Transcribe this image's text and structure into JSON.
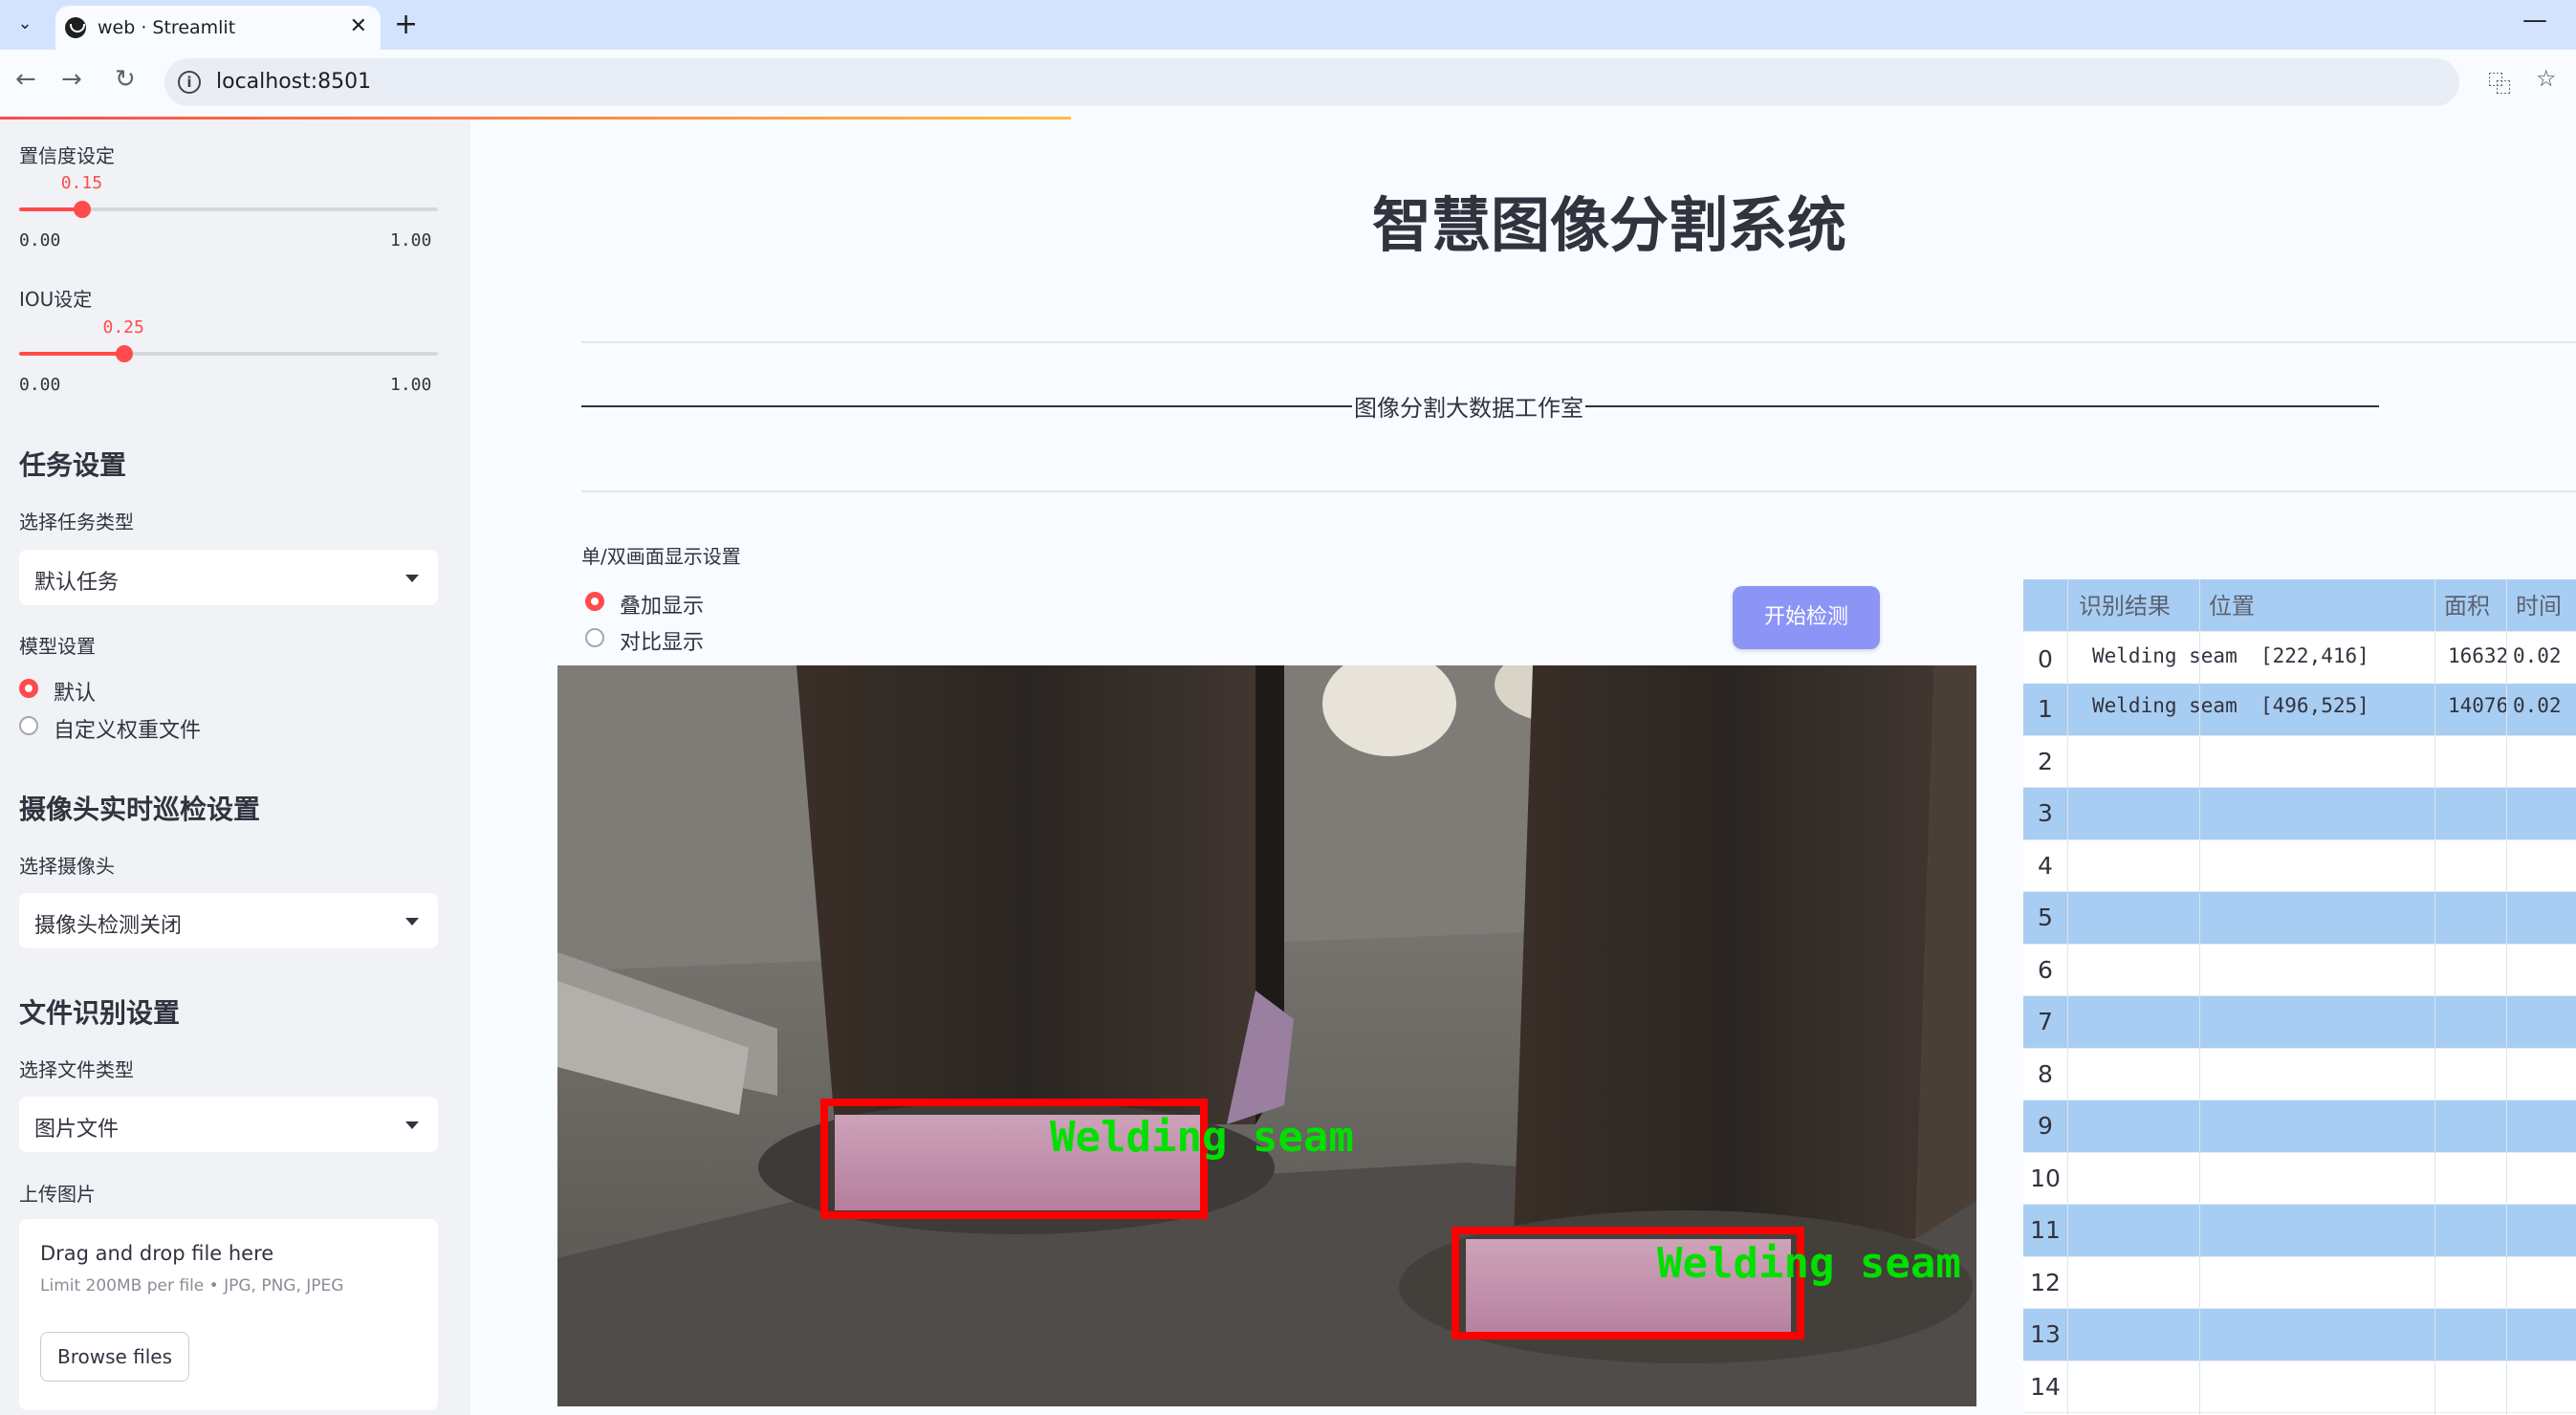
{
  "browser": {
    "tab_title": "web · Streamlit",
    "url": "localhost:8501"
  },
  "sidebar": {
    "confidence": {
      "label": "置信度设定",
      "value": "0.15",
      "min": "0.00",
      "max": "1.00",
      "fraction": 0.15
    },
    "iou": {
      "label": "IOU设定",
      "value": "0.25",
      "min": "0.00",
      "max": "1.00",
      "fraction": 0.25
    },
    "task_section": "任务设置",
    "task_type_label": "选择任务类型",
    "task_type_value": "默认任务",
    "model_label": "模型设置",
    "model_options": [
      "默认",
      "自定义权重文件"
    ],
    "model_selected": 0,
    "camera_section": "摄像头实时巡检设置",
    "camera_label": "选择摄像头",
    "camera_value": "摄像头检测关闭",
    "file_section": "文件识别设置",
    "file_type_label": "选择文件类型",
    "file_type_value": "图片文件",
    "upload_label": "上传图片",
    "upload_drop": "Drag and drop file here",
    "upload_limit": "Limit 200MB per file • JPG, PNG, JPEG",
    "upload_button": "Browse files"
  },
  "main": {
    "title": "智慧图像分割系统",
    "subtitle": "图像分割大数据工作室",
    "display_mode_label": "单/双画面显示设置",
    "display_options": [
      "叠加显示",
      "对比显示"
    ],
    "display_selected": 0,
    "start_button": "开始检测",
    "detections": [
      {
        "label": "Welding seam"
      },
      {
        "label": "Welding seam"
      }
    ]
  },
  "table": {
    "headers": [
      "识别结果",
      "位置",
      "面积",
      "时间"
    ],
    "rows": [
      {
        "index": "0",
        "result": "Welding seam",
        "position": "[222,416]",
        "area": "16632",
        "time": "0.02"
      },
      {
        "index": "1",
        "result": "Welding seam",
        "position": "[496,525]",
        "area": "14076",
        "time": "0.02"
      },
      {
        "index": "2"
      },
      {
        "index": "3"
      },
      {
        "index": "4"
      },
      {
        "index": "5"
      },
      {
        "index": "6"
      },
      {
        "index": "7"
      },
      {
        "index": "8"
      },
      {
        "index": "9"
      },
      {
        "index": "10"
      },
      {
        "index": "11"
      },
      {
        "index": "12"
      },
      {
        "index": "13"
      },
      {
        "index": "14"
      }
    ]
  },
  "colors": {
    "accent": "#ff4b4b",
    "button": "#8c95f5",
    "table_stripe": "#a8cdf2",
    "detection_box": "#ff0000",
    "detection_text": "#00e000"
  }
}
